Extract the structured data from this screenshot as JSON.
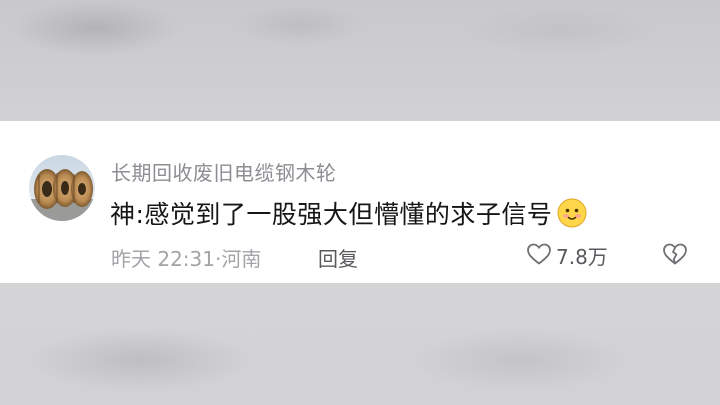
{
  "comment": {
    "username": "长期回收废旧电缆钢木轮",
    "text": "神:感觉到了一股强大但懵懂的求子信号",
    "emoji_icon": "smiling-face-emoji",
    "time": "昨天 22:31",
    "separator": "·",
    "location": "河南",
    "reply_label": "回复",
    "like_count": "7.8万",
    "like_icon": "heart-outline-icon",
    "dislike_icon": "broken-heart-icon"
  },
  "colors": {
    "card_background": "#ffffff",
    "username": "#8d8d93",
    "text": "#161616",
    "meta": "#a3a3a8",
    "action": "#5a5a5e",
    "page_background": "#cfcfd1"
  }
}
